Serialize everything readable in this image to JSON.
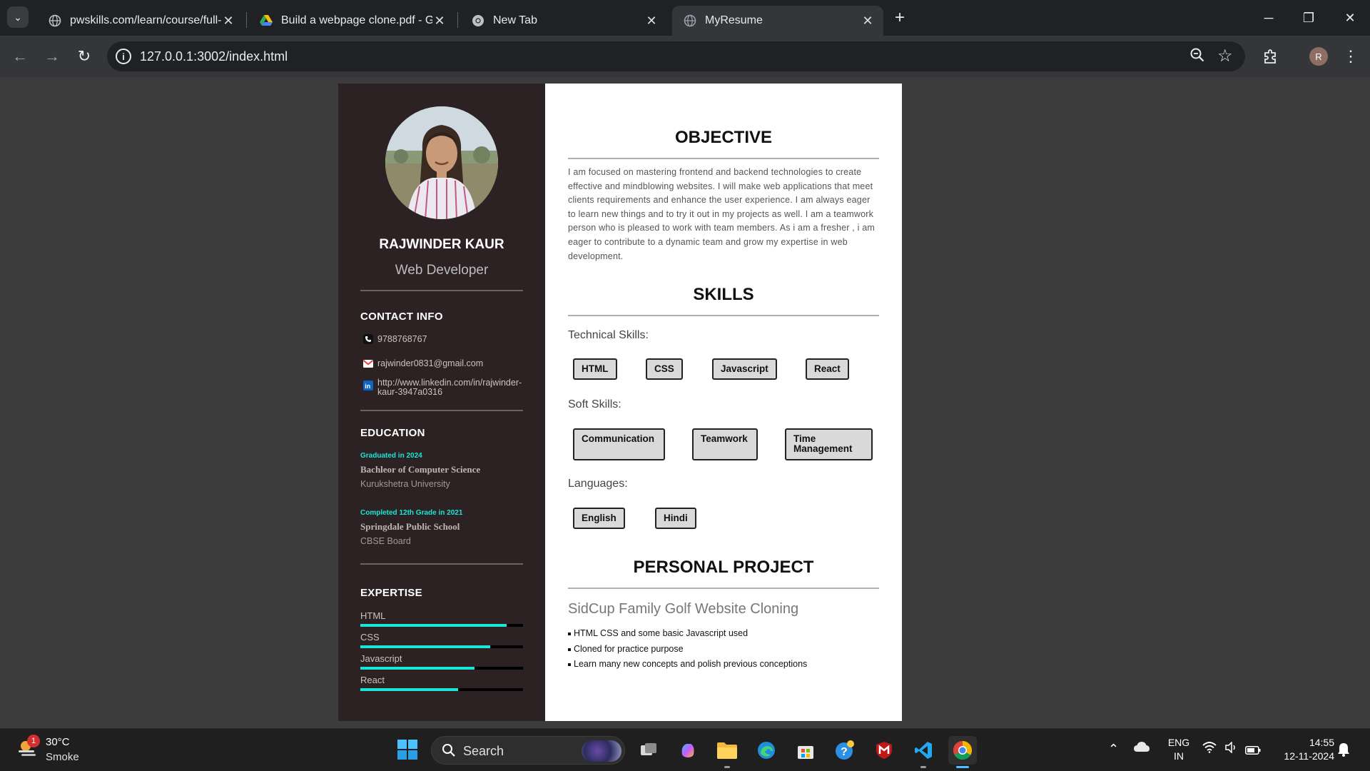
{
  "browser": {
    "tabs": [
      {
        "title": "pwskills.com/learn/course/full-s",
        "icon": "globe-icon",
        "active": false
      },
      {
        "title": "Build a webpage clone.pdf - Go",
        "icon": "google-drive-icon",
        "active": false
      },
      {
        "title": "New Tab",
        "icon": "chrome-icon",
        "active": false
      },
      {
        "title": "MyResume",
        "icon": "globe-icon",
        "active": true
      }
    ],
    "url": "127.0.0.1:3002/index.html",
    "profile_initial": "R"
  },
  "resume": {
    "name": "RAJWINDER KAUR",
    "role": "Web Developer",
    "contact": {
      "heading": "CONTACT INFO",
      "phone": "9788768767",
      "email": "rajwinder0831@gmail.com",
      "linkedin_line1": "http://www.linkedin.com/in/rajwinder-",
      "linkedin_line2": "kaur-3947a0316"
    },
    "education": {
      "heading": "EDUCATION",
      "items": [
        {
          "date": "Graduated in 2024",
          "degree": "Bachleor of Computer Science",
          "institution": "Kurukshetra University"
        },
        {
          "date": "Completed 12th Grade in 2021",
          "degree": "Springdale Public School",
          "institution": "CBSE Board"
        }
      ]
    },
    "expertise": {
      "heading": "EXPERTISE",
      "items": [
        {
          "label": "HTML",
          "level": 0.9
        },
        {
          "label": "CSS",
          "level": 0.8
        },
        {
          "label": "Javascript",
          "level": 0.7
        },
        {
          "label": "React",
          "level": 0.6
        }
      ]
    },
    "objective": {
      "heading": "OBJECTIVE",
      "text": "I am focused on mastering frontend and backend technologies to create effective and mindblowing websites. I will make web applications that meet clients requirements and enhance the user experience. I am always eager to learn new things and to try it out in my projects as well. I am a teamwork person who is pleased to work with team members. As i am a fresher , i am eager to contribute to a dynamic team and grow my expertise in web development."
    },
    "skills": {
      "heading": "SKILLS",
      "technical_label": "Technical Skills:",
      "technical": [
        "HTML",
        "CSS",
        "Javascript",
        "React"
      ],
      "soft_label": "Soft Skills:",
      "soft": [
        "Communication",
        "Teamwork",
        "Time Management"
      ],
      "languages_label": "Languages:",
      "languages": [
        "English",
        "Hindi"
      ]
    },
    "project": {
      "heading": "PERSONAL PROJECT",
      "title": "SidCup Family Golf Website Cloning",
      "points": [
        "HTML CSS and some basic Javascript used",
        "Cloned for practice purpose",
        "Learn many new concepts and polish previous conceptions"
      ]
    }
  },
  "taskbar": {
    "weather_temp": "30°C",
    "weather_desc": "Smoke",
    "weather_badge": "1",
    "search_placeholder": "Search",
    "lang_line1": "ENG",
    "lang_line2": "IN",
    "time": "14:55",
    "date": "12-11-2024"
  },
  "colors": {
    "sidebar_bg": "#2c2223",
    "accent": "#19e6d6",
    "chrome_bg": "#202124"
  }
}
